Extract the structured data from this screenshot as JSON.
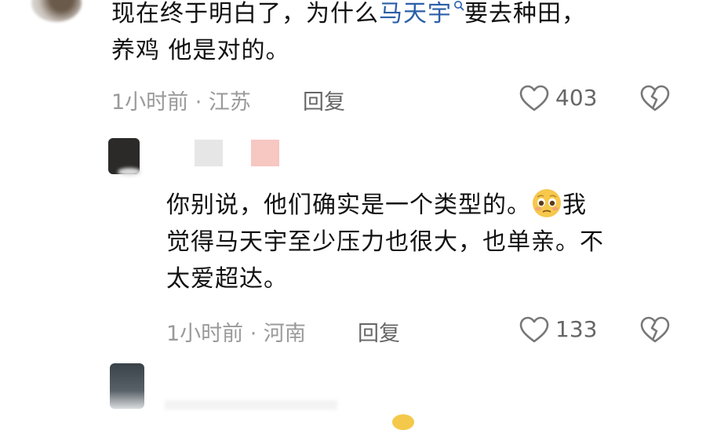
{
  "comments": [
    {
      "line1_pre": "现在终于明白了，为什么",
      "line1_link": "马天宇",
      "line1_post": "要去种田，",
      "line2": "养鸡 他是对的。",
      "time": "1小时前 · 江苏",
      "reply_label": "回复",
      "likes": "403",
      "icons": [
        "search-icon",
        "heart-icon",
        "broken-heart-icon"
      ]
    },
    {
      "line1_pre": "你别说，他们确实是一个类型的。",
      "line1_post": "我",
      "line2": "觉得马天宇至少压力也很大，也单亲。不",
      "line3": "太爱超达。",
      "time": "1小时前 · 河南",
      "reply_label": "回复",
      "likes": "133",
      "icons": [
        "pleading-face-emoji",
        "heart-icon",
        "broken-heart-icon"
      ]
    }
  ],
  "colors": {
    "link": "#2a5fa8",
    "meta": "#9a9a9a",
    "icon": "#777777"
  }
}
